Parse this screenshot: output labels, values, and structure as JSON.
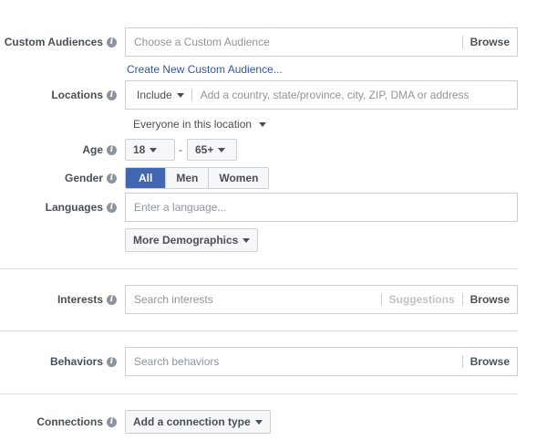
{
  "custom_audiences": {
    "label": "Custom Audiences",
    "placeholder": "Choose a Custom Audience",
    "browse": "Browse",
    "create_link": "Create New Custom Audience..."
  },
  "locations": {
    "label": "Locations",
    "include": "Include",
    "placeholder": "Add a country, state/province, city, ZIP, DMA or address",
    "scope": "Everyone in this location"
  },
  "age": {
    "label": "Age",
    "min": "18",
    "dash": "-",
    "max": "65+"
  },
  "gender": {
    "label": "Gender",
    "options": [
      "All",
      "Men",
      "Women"
    ],
    "selected": "All"
  },
  "languages": {
    "label": "Languages",
    "placeholder": "Enter a language...",
    "more_button": "More Demographics"
  },
  "interests": {
    "label": "Interests",
    "placeholder": "Search interests",
    "suggestions": "Suggestions",
    "browse": "Browse"
  },
  "behaviors": {
    "label": "Behaviors",
    "placeholder": "Search behaviors",
    "browse": "Browse"
  },
  "connections": {
    "label": "Connections",
    "button": "Add a connection type"
  },
  "info_glyph": "i",
  "colors": {
    "accent": "#4267b2",
    "link": "#365899",
    "text": "#4b4f56",
    "placeholder": "#90949c",
    "border": "#ccd0d5"
  }
}
